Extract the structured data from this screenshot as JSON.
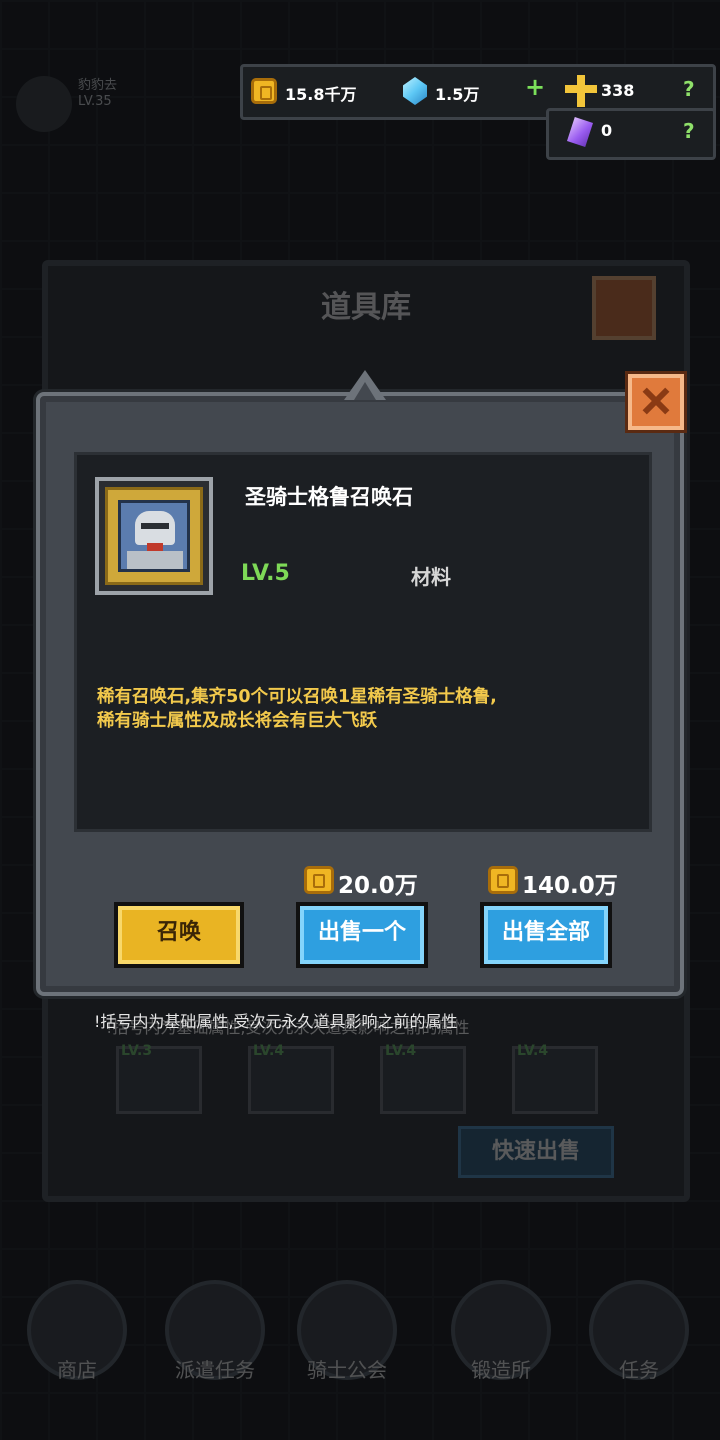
{
  "background": {
    "player_name": "豹豹去",
    "player_level": "LV.35",
    "panel_title": "道具库",
    "note": "!括号内为基础属性,受次元永久道具影响之前的属性",
    "slot_levels": [
      "LV.3",
      "LV.4",
      "LV.4",
      "LV.4"
    ],
    "quick_sell_label": "快速出售",
    "nav_items": [
      "商店",
      "派遣任务",
      "骑士公会",
      "锻造所",
      "任务"
    ]
  },
  "currency": {
    "gold": "15.8千万",
    "diamond": "1.5万",
    "add_symbol": "+",
    "cross": "338",
    "crystal": "0",
    "help_symbol": "?"
  },
  "item": {
    "name": "圣骑士格鲁召唤石",
    "level": "LV.5",
    "type": "材料",
    "description_line1": "稀有召唤石,集齐50个可以召唤1星稀有圣骑士格鲁,",
    "description_line2": "稀有骑士属性及成长将会有巨大飞跃"
  },
  "prices": {
    "sell_one": "20.0万",
    "sell_all": "140.0万"
  },
  "buttons": {
    "summon": "召唤",
    "sell_one": "出售一个",
    "sell_all": "出售全部"
  },
  "colors": {
    "accent_yellow": "#e9b423",
    "accent_blue": "#2e9fe0",
    "level_green": "#7ed957",
    "desc_gold": "#f2c94c",
    "close_orange": "#e07a3c"
  }
}
